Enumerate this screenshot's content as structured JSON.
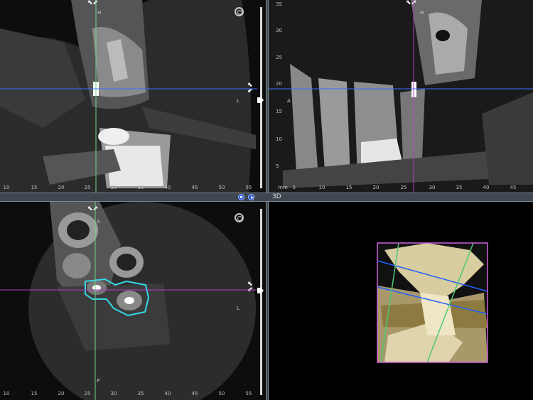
{
  "panels": {
    "axial_top": {
      "orient_top": "H",
      "orient_right": "L",
      "ruler_x": [
        "10",
        "15",
        "20",
        "25",
        "30",
        "35",
        "40",
        "45",
        "50",
        "55"
      ]
    },
    "sagittal": {
      "orient_top": "H",
      "orient_left": "A",
      "ruler_y": [
        "35",
        "30",
        "25",
        "20",
        "15",
        "10",
        "5"
      ],
      "ruler_x": [
        "mm",
        "5",
        "10",
        "15",
        "20",
        "25",
        "30",
        "35",
        "40",
        "45"
      ]
    },
    "axial_bottom": {
      "orient_top": "A",
      "orient_bottom": "P",
      "orient_right": "L",
      "ruler_x": [
        "10",
        "15",
        "20",
        "25",
        "30",
        "35",
        "40",
        "45",
        "50",
        "55"
      ]
    },
    "volume_3d": {
      "label": "3D"
    }
  },
  "colors": {
    "crosshair_green": "#6cd48a",
    "crosshair_blue": "#3c6cff",
    "crosshair_purple": "#b040c8",
    "roi_cyan": "#35d8e8",
    "separator": "#3f4850"
  },
  "icons": {
    "reset_view": "reset-view-icon",
    "play": "play-icon",
    "stop": "stop-icon",
    "pan_arrows": "pan-arrows-icon"
  }
}
